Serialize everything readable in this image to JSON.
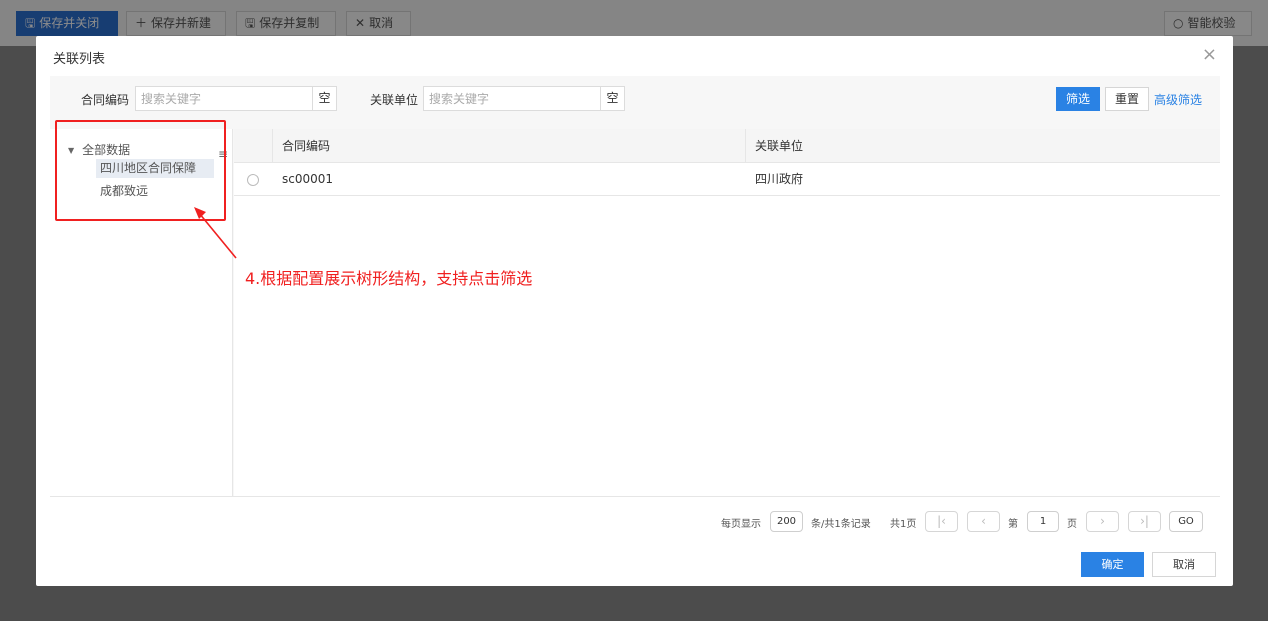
{
  "toolbar": {
    "save_close": "保存并关闭",
    "save_new": "保存并新建",
    "save_copy": "保存并复制",
    "cancel": "取消",
    "smart_check": "智能校验"
  },
  "dialog": {
    "title": "关联列表",
    "close_icon": "×"
  },
  "search": {
    "contract_code_label": "合同编码",
    "contract_code_placeholder": "搜索关键字",
    "contract_code_value": "",
    "related_unit_label": "关联单位",
    "related_unit_placeholder": "搜索关键字",
    "related_unit_value": "",
    "clear_label": "空",
    "filter_button": "筛选",
    "reset_button": "重置",
    "advanced_link": "高级筛选"
  },
  "tree": {
    "handle_icon": "≡",
    "root": "全部数据",
    "nodes": [
      {
        "label": "四川地区合同保障",
        "selected": true
      },
      {
        "label": "成都致远",
        "selected": false
      }
    ]
  },
  "table": {
    "columns": [
      "合同编码",
      "关联单位"
    ],
    "rows": [
      {
        "code": "sc00001",
        "unit": "四川政府",
        "selected": false
      }
    ]
  },
  "pager": {
    "per_page_label": "每页显示",
    "per_page_value": "200",
    "total_text": "条/共1条记录",
    "pages_text": "共1页",
    "page_prefix": "第",
    "page_value": "1",
    "page_suffix": "页",
    "go_label": "GO"
  },
  "footer": {
    "ok": "确定",
    "cancel": "取消"
  },
  "annotation": {
    "text": "4.根据配置展示树形结构，支持点击筛选",
    "color": "#f02020"
  }
}
